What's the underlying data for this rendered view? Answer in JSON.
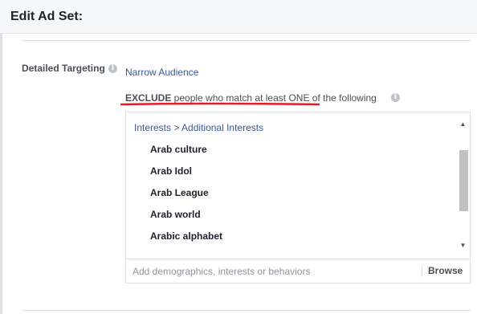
{
  "header": {
    "title": "Edit Ad Set:"
  },
  "targeting": {
    "label": "Detailed Targeting",
    "narrow_link": "Narrow Audience",
    "exclude_bold": "EXCLUDE",
    "exclude_rest": " people who match at least ",
    "exclude_one": "ONE",
    "exclude_tail": " of the following",
    "breadcrumb": {
      "parent": "Interests",
      "separator": " > ",
      "child": "Additional Interests"
    },
    "items": [
      {
        "label": "Arab culture"
      },
      {
        "label": "Arab Idol"
      },
      {
        "label": "Arab League"
      },
      {
        "label": "Arab world"
      },
      {
        "label": "Arabic alphabet"
      }
    ],
    "search_placeholder": "Add demographics, interests or behaviors",
    "browse_label": "Browse"
  },
  "icons": {
    "info": "info-icon",
    "scroll_up": "triangle-up-icon",
    "scroll_down": "triangle-down-icon"
  },
  "colors": {
    "link": "#365899",
    "annotation_underline": "#e41e26",
    "text_dark": "#1d2129",
    "text_muted": "#4b4f56"
  }
}
